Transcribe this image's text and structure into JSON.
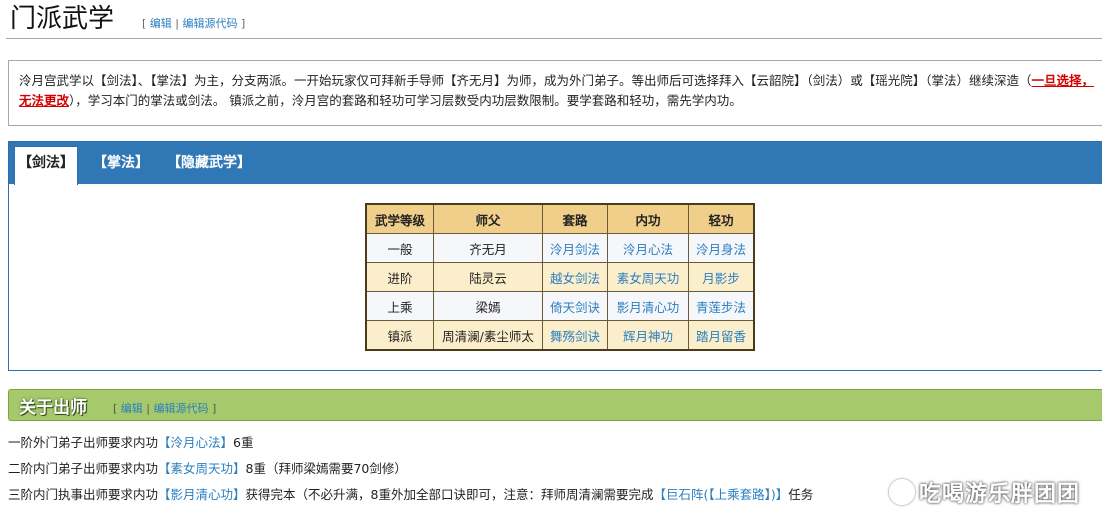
{
  "header": {
    "title": "门派武学",
    "edit_open": "[",
    "edit_label": "编辑",
    "edit_sep": "|",
    "edit_source_label": "编辑源代码",
    "edit_close": "]"
  },
  "intro": {
    "text_before": "泠月宫武学以【剑法】、【掌法】为主，分支两派。一开始玩家仅可拜新手导师【齐无月】为师，成为外门弟子。等出师后可选择拜入【云韶院】（剑法）或【瑶光院】（掌法）继续深造（",
    "warning": "一旦选择，无法更改",
    "text_after": "），学习本门的掌法或剑法。 镇派之前，泠月宫的套路和轻功可学习层数受内功层数限制。要学套路和轻功，需先学内功。"
  },
  "tabs": [
    {
      "label": "【剑法】",
      "active": true
    },
    {
      "label": "【掌法】",
      "active": false
    },
    {
      "label": "【隐藏武学】",
      "active": false
    }
  ],
  "table": {
    "headers": [
      "武学等级",
      "师父",
      "套路",
      "内功",
      "轻功"
    ],
    "rows": [
      {
        "level": "一般",
        "master": "齐无月",
        "skill": "泠月剑法",
        "neigong": "泠月心法",
        "qinggong": "泠月身法"
      },
      {
        "level": "进阶",
        "master": "陆灵云",
        "skill": "越女剑法",
        "neigong": "素女周天功",
        "qinggong": "月影步"
      },
      {
        "level": "上乘",
        "master": "梁嫣",
        "skill": "倚天剑诀",
        "neigong": "影月清心功",
        "qinggong": "青莲步法"
      },
      {
        "level": "镇派",
        "master": "周清澜/素尘师太",
        "skill": "舞殇剑诀",
        "neigong": "辉月神功",
        "qinggong": "踏月留香"
      }
    ]
  },
  "section": {
    "title": "关于出师",
    "edit_open": "[",
    "edit_label": "编辑",
    "edit_sep": "|",
    "edit_source_label": "编辑源代码",
    "edit_close": "]"
  },
  "lines": [
    {
      "prefix": "一阶外门弟子出师要求内功",
      "link": "【泠月心法】",
      "suffix": "6重"
    },
    {
      "prefix": "二阶内门弟子出师要求内功",
      "link": "【素女周天功】",
      "suffix": "8重（拜师梁嫣需要70剑修）"
    },
    {
      "prefix": "三阶内门执事出师要求内功",
      "link": "【影月清心功】",
      "suffix": "获得完本（不必升满，8重外加全部口诀即可，注意：拜师周清澜需要完成",
      "link2": "【巨石阵(【上乘套路】)】",
      "suffix2": "任务"
    }
  ],
  "watermark": "吃喝游乐胖团团"
}
